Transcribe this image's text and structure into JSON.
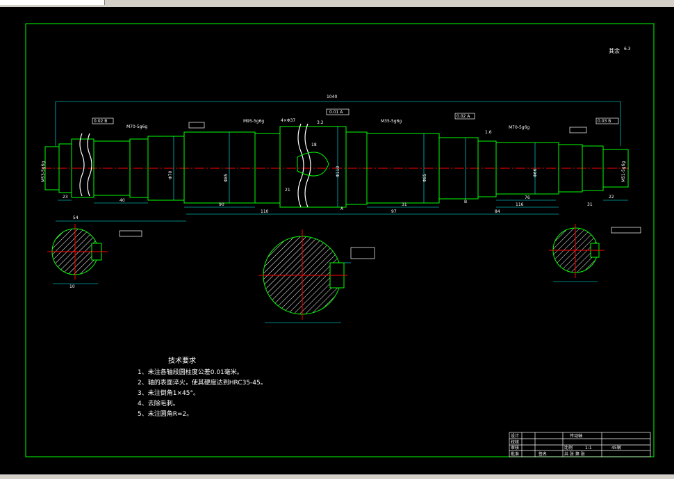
{
  "title_block": {
    "labels": [
      "设计",
      "校核",
      "审核",
      "批准"
    ],
    "part_name": "传动轴",
    "scale_label": "比例",
    "scale_value": "1:1",
    "material": "45钢",
    "sheet": "共 张 第 张",
    "sign": "签名"
  },
  "roughness_note": "其余",
  "notes": {
    "heading": "技术要求",
    "items": [
      "1、未注各轴段圆柱度公差0.01毫米。",
      "2、轴的表面淬火，使其硬度达到HRC35-45。",
      "3、未注倒角1×45°。",
      "4、去除毛刺。",
      "5、未注圆角R=2。"
    ]
  },
  "dimensions": {
    "thread_1": "M70-5g6g",
    "thread_2": "M95-5g6g",
    "thread_3": "M35-5g6g",
    "thread_4": "M70-5g6g",
    "thread_left": "M53-5g6g",
    "thread_right": "M51-5g6g",
    "chamfer_mid": "4×Φ37",
    "total_length": "1040",
    "len_a": "54",
    "len_b": "40",
    "len_c": "90",
    "len_d": "110",
    "len_e": "31",
    "len_f": "97",
    "len_g": "84",
    "len_h": "116",
    "len_i": "76",
    "len_j": "23",
    "len_k": "22",
    "len_l": "21",
    "len_m": "31",
    "dia_a": "Φ70",
    "dia_b": "Φ85",
    "dia_c": "Φ110",
    "dia_d": "Φ85",
    "dia_e": "Φ66",
    "gtol_a": "0.02 B",
    "gtol_b": "0.01 A",
    "gtol_c": "0.02 A",
    "gtol_d": "0.03 B",
    "section_a": "18",
    "section_b": "10",
    "datum_a": "A",
    "datum_b": "B",
    "roughness_a": "3.2",
    "roughness_b": "1.6",
    "roughness_c": "6.3"
  }
}
